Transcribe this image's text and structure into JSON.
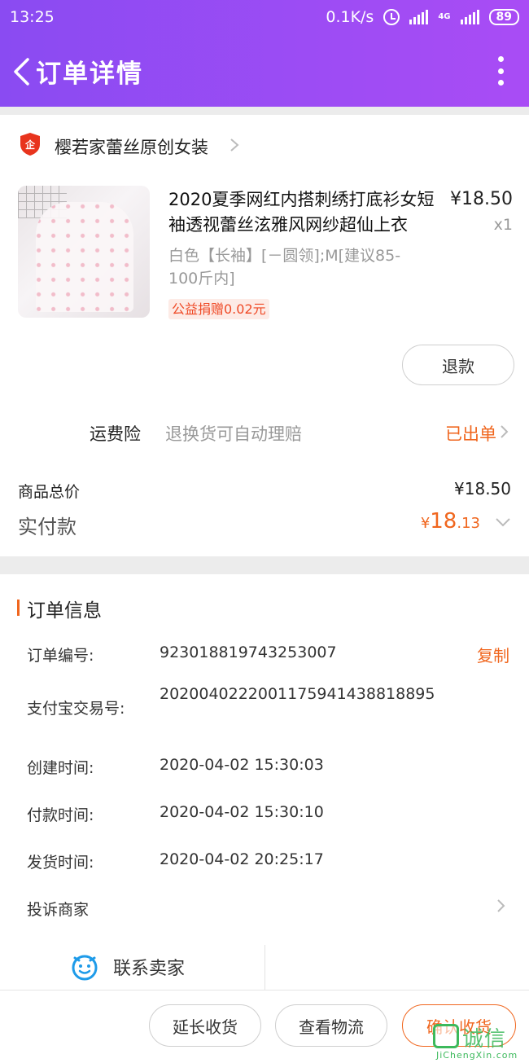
{
  "status_bar": {
    "time": "13:25",
    "net_speed": "0.1K/s",
    "network_type": "4G",
    "battery": "89"
  },
  "nav": {
    "title": "订单详情"
  },
  "shop": {
    "name": "樱若家蕾丝原创女装",
    "badge_icon": "shield-enterprise-icon"
  },
  "product": {
    "title": "2020夏季网红内搭刺绣打底衫女短袖透视蕾丝泫雅风网纱超仙上衣",
    "price": "¥18.50",
    "quantity": "x1",
    "spec": "白色【长袖】[－圆领];M[建议85-100斤内]",
    "charity": "公益捐赠0.02元",
    "refund_label": "退款"
  },
  "insurance": {
    "label": "运费险",
    "description": "退换货可自动理赔",
    "status": "已出单"
  },
  "totals": {
    "goods_total_label": "商品总价",
    "goods_total_value": "¥18.50",
    "paid_label": "实付款",
    "paid_currency": "¥",
    "paid_integer": "18",
    "paid_decimal": ".13"
  },
  "order_info": {
    "section_title": "订单信息",
    "copy_label": "复制",
    "rows": [
      {
        "label": "订单编号:",
        "value": "923018819743253007"
      },
      {
        "label": "支付宝交易号:",
        "value": "2020040222001175941438818895"
      },
      {
        "label": "创建时间:",
        "value": "2020-04-02 15:30:03"
      },
      {
        "label": "付款时间:",
        "value": "2020-04-02 15:30:10"
      },
      {
        "label": "发货时间:",
        "value": "2020-04-02 20:25:17"
      }
    ],
    "complain_label": "投诉商家",
    "contact_label": "联系卖家"
  },
  "bottom_bar": {
    "extend_label": "延长收货",
    "logistics_label": "查看物流",
    "confirm_label": "确认收货"
  },
  "watermark": {
    "text": "诚信",
    "url": "JiChengXin.com"
  },
  "colors": {
    "header_start": "#8a4bf2",
    "header_end": "#a94cf5",
    "accent": "#f0661e",
    "muted": "#999999"
  }
}
